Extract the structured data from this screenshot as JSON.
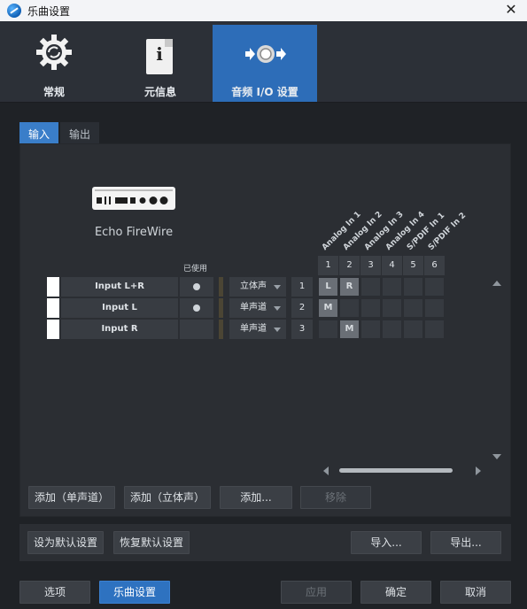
{
  "window": {
    "title": "乐曲设置",
    "close_glyph": "✕"
  },
  "categories": [
    {
      "label": "常规",
      "icon": "gear-icon",
      "active": false
    },
    {
      "label": "元信息",
      "icon": "info-document-icon",
      "active": false
    },
    {
      "label": "音频 I/O 设置",
      "icon": "audio-io-icon",
      "active": true
    }
  ],
  "io_tabs": [
    {
      "label": "输入",
      "active": true
    },
    {
      "label": "输出",
      "active": false
    }
  ],
  "device": {
    "name": "Echo FireWire",
    "icon": "audio-interface-icon"
  },
  "matrix": {
    "used_header": "已使用",
    "columns": [
      {
        "num": "1",
        "label": "Analog In 1"
      },
      {
        "num": "2",
        "label": "Analog In 2"
      },
      {
        "num": "3",
        "label": "Analog In 3"
      },
      {
        "num": "4",
        "label": "Analog In 4"
      },
      {
        "num": "5",
        "label": "S/PDIF In 1"
      },
      {
        "num": "6",
        "label": "S/PDIF In 2"
      }
    ],
    "rows": [
      {
        "name": "Input L+R",
        "used": true,
        "type": "立体声",
        "index": "1",
        "cells": [
          "L",
          "R",
          "",
          "",
          "",
          ""
        ],
        "color": "#ffffff"
      },
      {
        "name": "Input L",
        "used": true,
        "type": "单声道",
        "index": "2",
        "cells": [
          "M",
          "",
          "",
          "",
          "",
          ""
        ],
        "color": "#ffffff"
      },
      {
        "name": "Input R",
        "used": false,
        "type": "单声道",
        "index": "3",
        "cells": [
          "",
          "M",
          "",
          "",
          "",
          ""
        ],
        "color": "#ffffff"
      }
    ]
  },
  "channel_buttons": {
    "add_mono": "添加（单声道）",
    "add_stereo": "添加（立体声）",
    "add": "添加...",
    "remove": "移除"
  },
  "preset_buttons": {
    "set_default": "设为默认设置",
    "restore_default": "恢复默认设置",
    "import": "导入...",
    "export": "导出..."
  },
  "footer": {
    "options": "选项",
    "song_setup": "乐曲设置",
    "apply": "应用",
    "ok": "确定",
    "cancel": "取消"
  },
  "colors": {
    "accent": "#2d6db8",
    "background": "#1f2226",
    "panel": "#2b2e33"
  }
}
